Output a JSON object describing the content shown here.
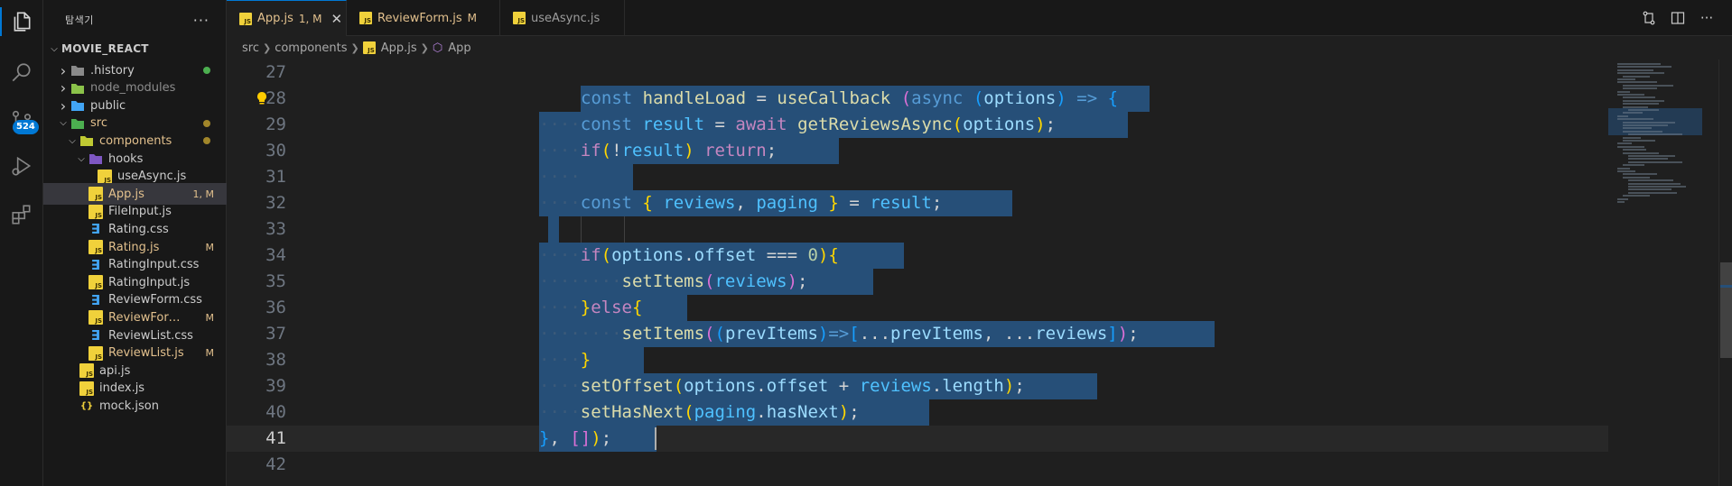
{
  "explorer": {
    "title": "탐색기",
    "more_icon": "ellipsis-icon",
    "project": "MOVIE_REACT",
    "items": [
      {
        "name": ".history",
        "type": "folder",
        "status": "",
        "dot": "#4caf50",
        "style": "normal"
      },
      {
        "name": "node_modules",
        "type": "folder",
        "status": "",
        "dot": "",
        "style": "dim"
      },
      {
        "name": "public",
        "type": "folder",
        "status": "",
        "dot": "",
        "style": "normal"
      },
      {
        "name": "src",
        "type": "folder",
        "status": "",
        "dot": "#a1862a",
        "style": "modified"
      },
      {
        "name": "components",
        "type": "folder",
        "status": "",
        "dot": "#a1862a",
        "style": "modified"
      },
      {
        "name": "hooks",
        "type": "folder",
        "status": "",
        "dot": "",
        "style": "normal"
      },
      {
        "name": "useAsync.js",
        "type": "js",
        "status": "",
        "dot": "",
        "style": "normal"
      },
      {
        "name": "App.js",
        "type": "js",
        "status": "1, M",
        "dot": "",
        "style": "modified"
      },
      {
        "name": "FileInput.js",
        "type": "js",
        "status": "",
        "dot": "",
        "style": "normal"
      },
      {
        "name": "Rating.css",
        "type": "css",
        "status": "",
        "dot": "",
        "style": "normal"
      },
      {
        "name": "Rating.js",
        "type": "js",
        "status": "M",
        "dot": "",
        "style": "modified"
      },
      {
        "name": "RatingInput.css",
        "type": "css",
        "status": "",
        "dot": "",
        "style": "normal"
      },
      {
        "name": "RatingInput.js",
        "type": "js",
        "status": "",
        "dot": "",
        "style": "normal"
      },
      {
        "name": "ReviewForm.css",
        "type": "css",
        "status": "",
        "dot": "",
        "style": "normal"
      },
      {
        "name": "ReviewForm...",
        "type": "js",
        "status": "M",
        "dot": "",
        "style": "modified"
      },
      {
        "name": "ReviewList.css",
        "type": "css",
        "status": "",
        "dot": "",
        "style": "normal"
      },
      {
        "name": "ReviewList.js",
        "type": "js",
        "status": "M",
        "dot": "",
        "style": "modified"
      },
      {
        "name": "api.js",
        "type": "js",
        "status": "",
        "dot": "",
        "style": "normal"
      },
      {
        "name": "index.js",
        "type": "js",
        "status": "",
        "dot": "",
        "style": "normal"
      },
      {
        "name": "mock.json",
        "type": "json",
        "status": "",
        "dot": "",
        "style": "normal"
      }
    ]
  },
  "activity": {
    "scm_badge": "524",
    "icons": [
      "files-icon",
      "search-icon",
      "source-control-icon",
      "run-debug-icon",
      "extensions-icon"
    ]
  },
  "tabs": [
    {
      "label": "App.js",
      "status": "1, M",
      "active": true,
      "modified": true
    },
    {
      "label": "ReviewForm.js",
      "status": "M",
      "active": false,
      "modified": true
    },
    {
      "label": "useAsync.js",
      "status": "",
      "active": false,
      "modified": false
    }
  ],
  "breadcrumb": [
    "src",
    "components",
    "App.js",
    "App"
  ],
  "editor": {
    "current_line": "41",
    "lines": [
      "27",
      "28",
      "29",
      "30",
      "31",
      "32",
      "33",
      "34",
      "35",
      "36",
      "37",
      "38",
      "39",
      "40",
      "41",
      "42"
    ]
  },
  "colors": {
    "selection": "#264f78",
    "accent": "#0078d4",
    "modified": "#e2c08d"
  }
}
